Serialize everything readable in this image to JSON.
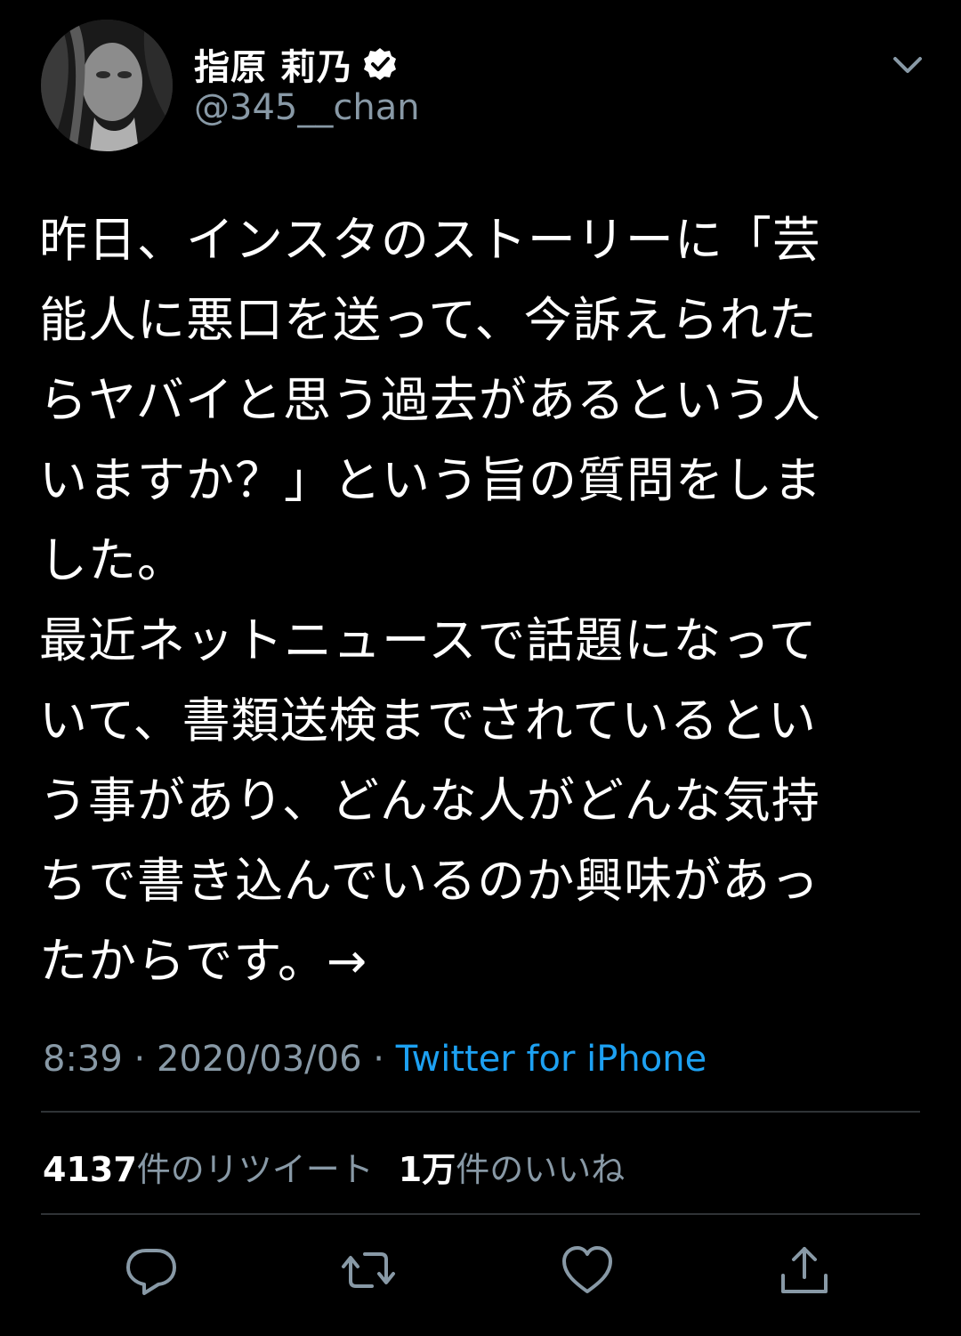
{
  "user": {
    "display_name": "指原 莉乃",
    "handle": "@345__chan",
    "verified": true
  },
  "tweet": {
    "text": "昨日、インスタのストーリーに「芸\n能人に悪口を送って、今訴えられた\nらヤバイと思う過去があるという人\nいますか？」という旨の質問をしま\nした。\n最近ネットニュースで話題になって\nいて、書類送検までされているとい\nう事があり、どんな人がどんな気持\nちで書き込んでいるのか興味があっ\nたからです。→"
  },
  "meta": {
    "time": "8:39",
    "separator1": " · ",
    "date": "2020/03/06",
    "separator2": " · ",
    "source": "Twitter for iPhone"
  },
  "stats": {
    "retweets_count": "4137",
    "retweets_label": "件のリツイート",
    "likes_count": "1万",
    "likes_label": "件のいいね"
  },
  "icons": {
    "avatar": "avatar-image",
    "verified": "verified-badge-icon",
    "menu": "chevron-down-icon",
    "reply": "reply-icon",
    "retweet": "retweet-icon",
    "like": "heart-icon",
    "share": "share-icon"
  },
  "colors": {
    "background": "#000000",
    "text": "#ffffff",
    "secondary": "#8899a6",
    "link": "#1da1f2",
    "divider": "#2f3336"
  }
}
